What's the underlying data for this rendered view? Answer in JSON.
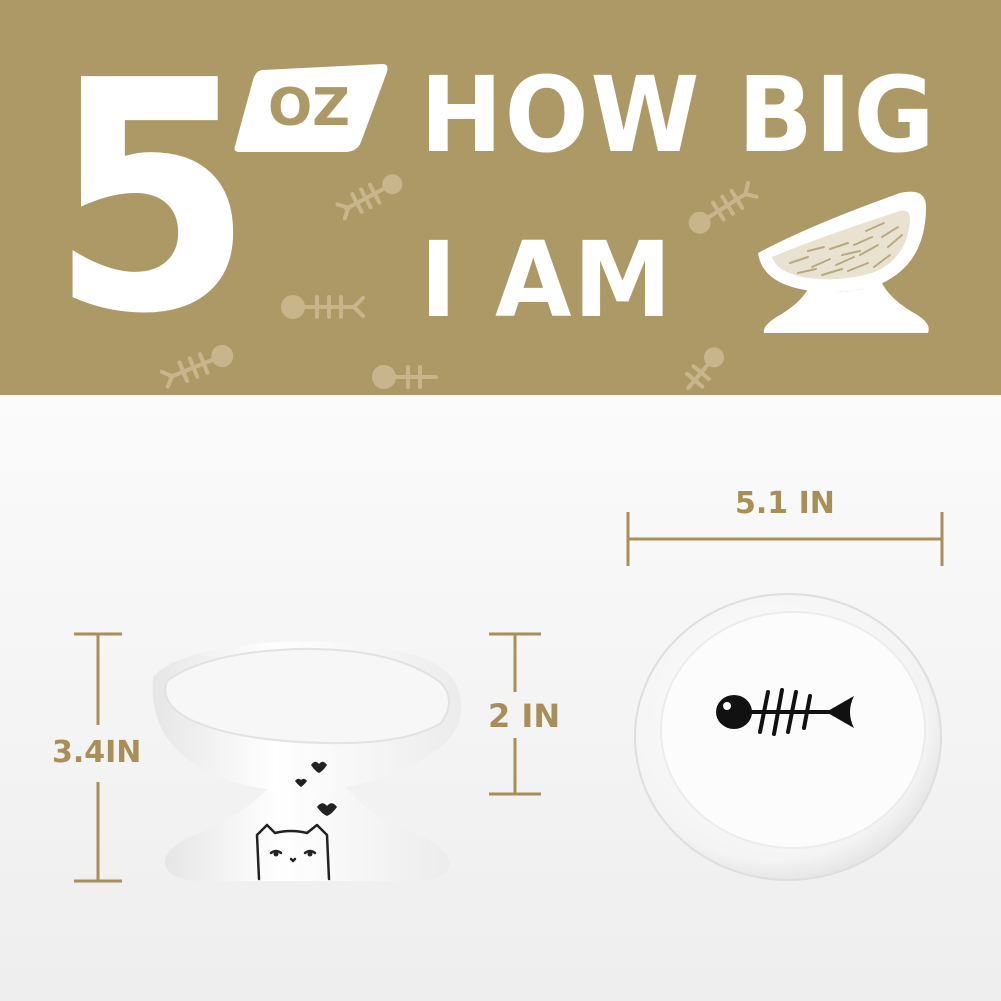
{
  "banner": {
    "capacity_number": "5",
    "capacity_unit": "OZ",
    "headline_line1": "HOW BIG",
    "headline_line2": "I AM",
    "colors": {
      "banner_bg": "#ad9966",
      "text": "#ffffff",
      "decor": "#c9b58c"
    }
  },
  "dimensions": {
    "height_total": "3.4IN",
    "height_bowl": "2 IN",
    "diameter": "5.1 IN",
    "color": "#a88f57"
  },
  "icons": [
    "fishbone-icon",
    "bowl-with-food-icon",
    "cat-face-icon",
    "heart-icon"
  ]
}
